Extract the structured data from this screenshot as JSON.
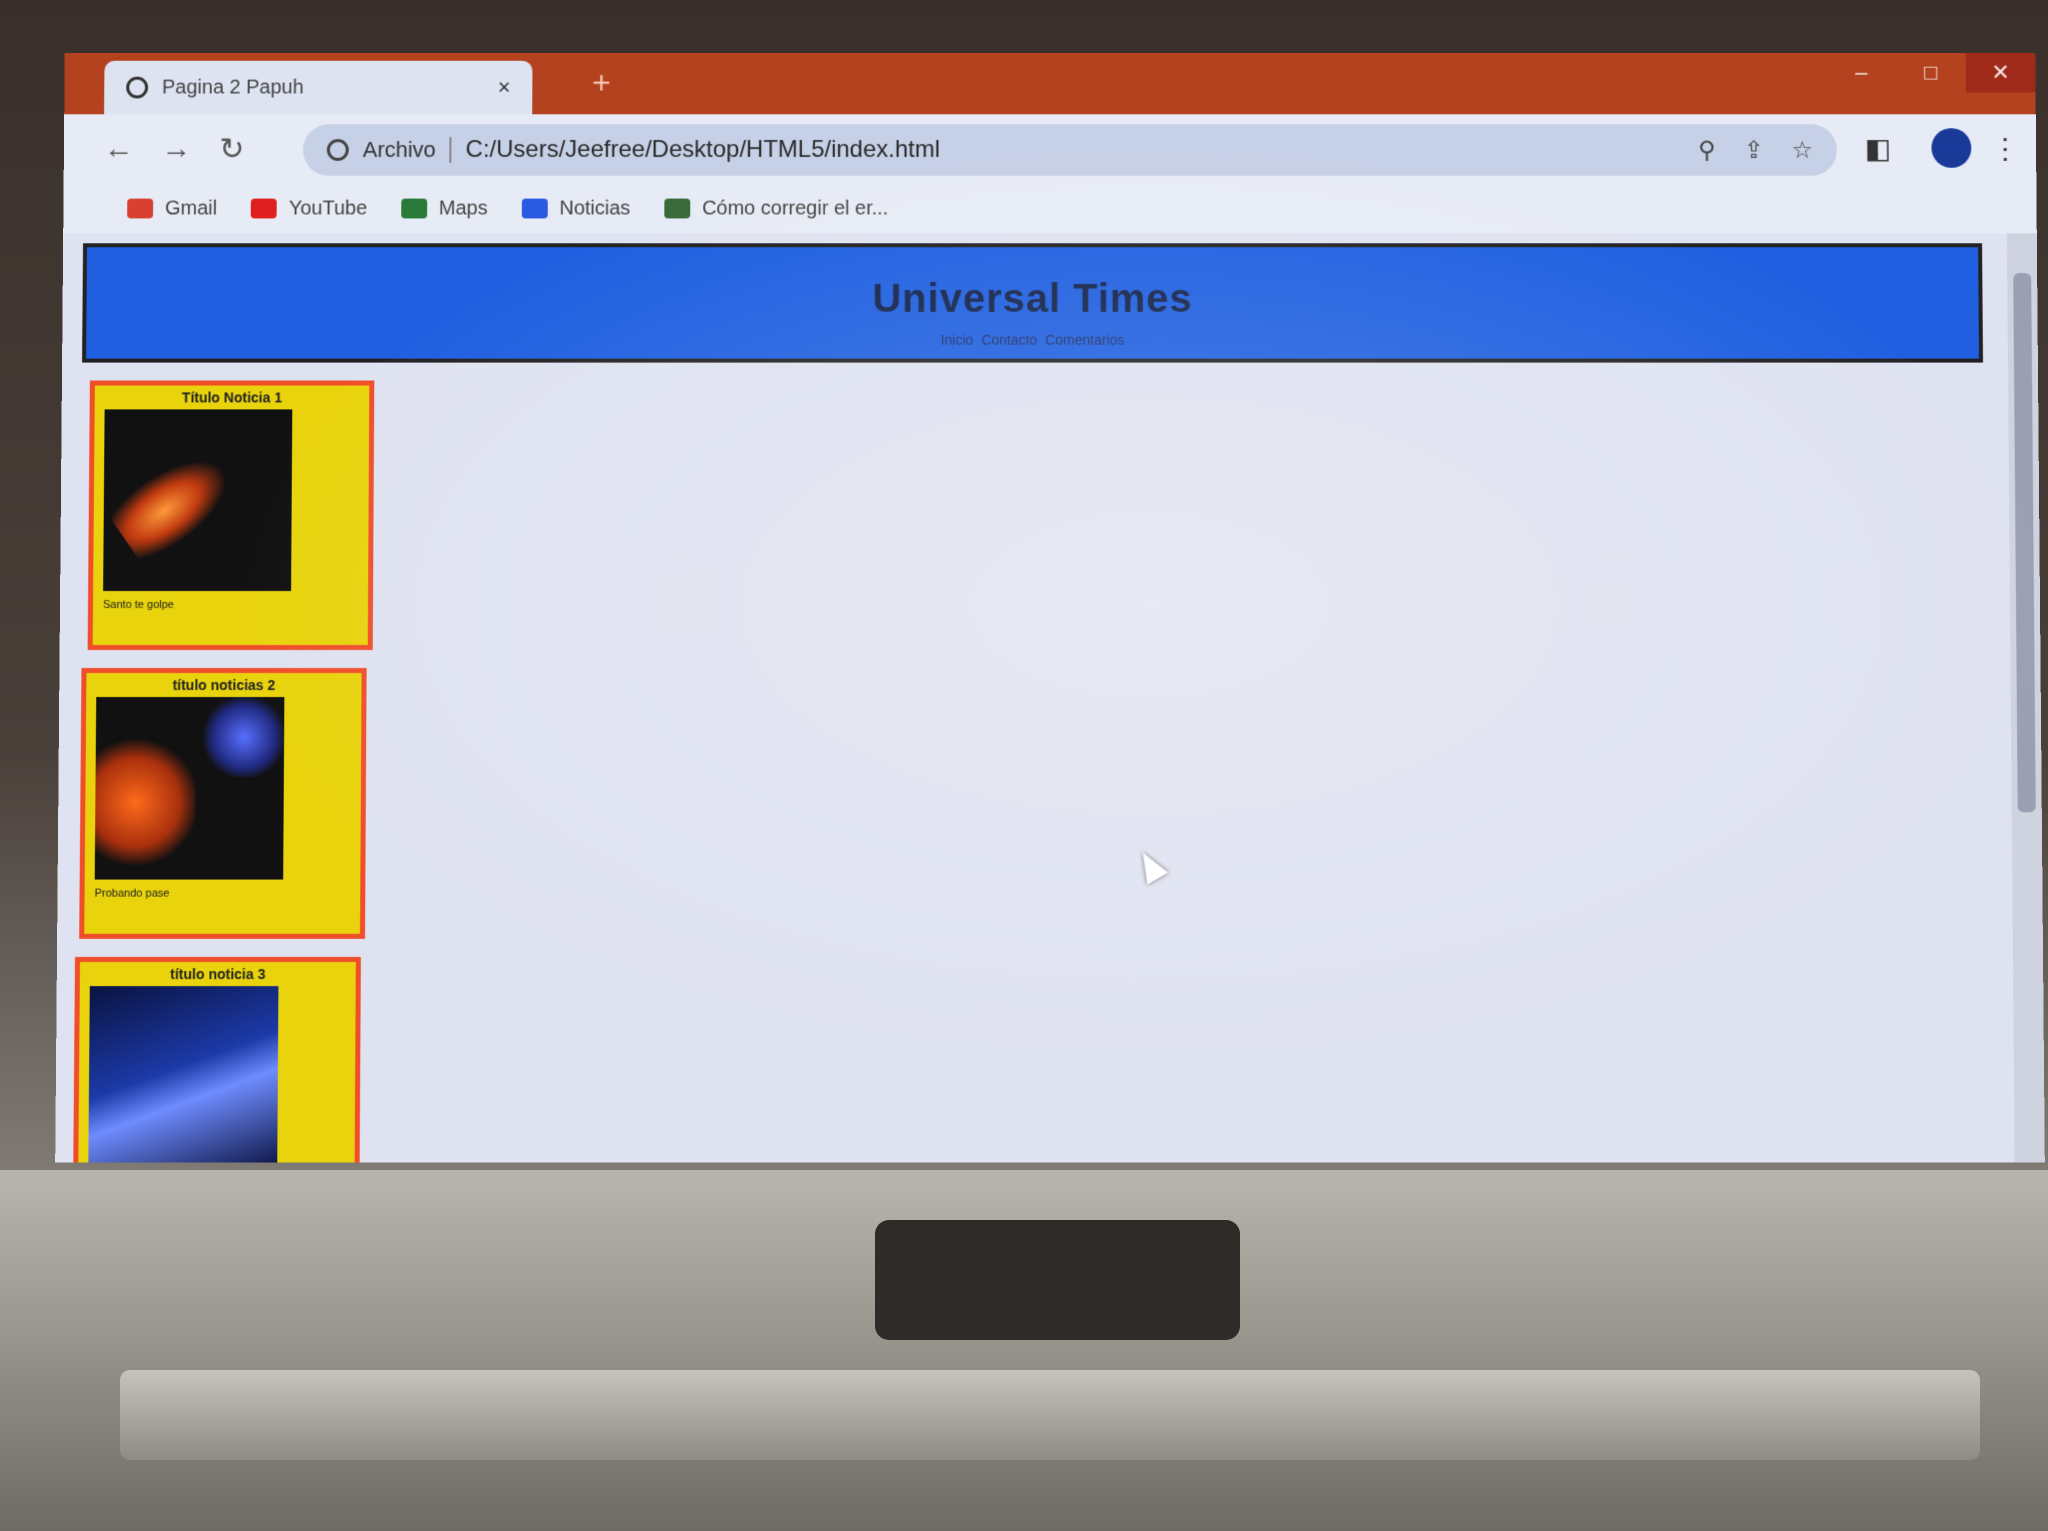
{
  "browser": {
    "tab_title": "Pagina 2 Papuh",
    "tab_close": "×",
    "new_tab": "+",
    "address": {
      "scheme": "Archivo",
      "url": "C:/Users/Jeefree/Desktop/HTML5/index.html"
    },
    "bookmarks": [
      {
        "label": "Gmail",
        "icon": "gmail-icon",
        "color": "#d94030"
      },
      {
        "label": "YouTube",
        "icon": "youtube-icon",
        "color": "#e02020"
      },
      {
        "label": "Maps",
        "icon": "maps-icon",
        "color": "#2a7a3a"
      },
      {
        "label": "Noticias",
        "icon": "news-icon",
        "color": "#2a5ae0"
      },
      {
        "label": "Cómo corregir el er...",
        "icon": "bookmark-page-icon",
        "color": "#3a6a3a"
      }
    ],
    "accent_color": "#b5421f"
  },
  "page": {
    "site_title": "Universal Times",
    "nav": [
      "Inicio",
      "Contacto",
      "Comentarios"
    ],
    "header_color": "#1f5fe0",
    "news": [
      {
        "title": "Título Noticia 1",
        "caption": "Santo te golpe"
      },
      {
        "title": "título noticias 2",
        "caption": "Probando pase"
      },
      {
        "title": "título noticia 3",
        "caption": ""
      }
    ],
    "card_color": "#e8d30c",
    "card_border_color": "#f04e2a"
  }
}
